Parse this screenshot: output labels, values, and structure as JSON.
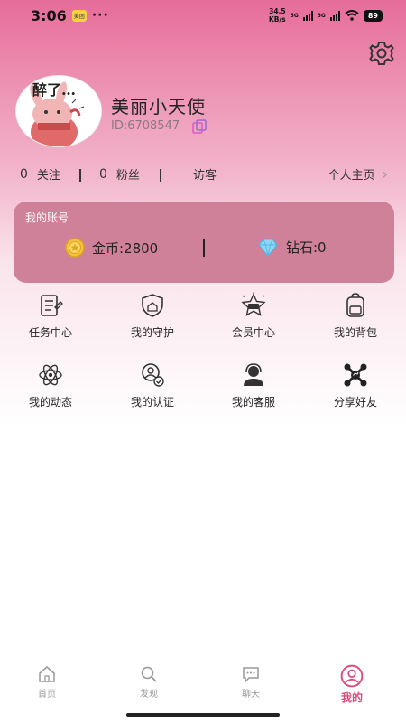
{
  "status_bar": {
    "time": "3:06",
    "notif_label": "美团",
    "dots": "···",
    "speed_top": "34.5",
    "speed_bottom": "KB/s",
    "net1": "5G",
    "net2": "5G",
    "battery": "89"
  },
  "profile": {
    "avatar_text": "醉了…",
    "nickname": "美丽小天使",
    "id": "ID:6708547"
  },
  "stats": {
    "following_count": "0",
    "following_label": "关注",
    "fans_count": "0",
    "fans_label": "粉丝",
    "visitors_label": "访客",
    "home_label": "个人主页",
    "chevron": "›"
  },
  "account": {
    "title": "我的账号",
    "gold_label": "金币:2800",
    "diamond_label": "钻石:0"
  },
  "grid": {
    "items": [
      {
        "label": "任务中心",
        "icon": "task-icon"
      },
      {
        "label": "我的守护",
        "icon": "guard-icon"
      },
      {
        "label": "会员中心",
        "icon": "vip-icon"
      },
      {
        "label": "我的背包",
        "icon": "backpack-icon"
      },
      {
        "label": "我的动态",
        "icon": "atom-icon"
      },
      {
        "label": "我的认证",
        "icon": "verify-icon"
      },
      {
        "label": "我的客服",
        "icon": "support-icon"
      },
      {
        "label": "分享好友",
        "icon": "share-icon"
      }
    ]
  },
  "tabbar": {
    "tabs": [
      {
        "label": "首页",
        "icon": "home-icon"
      },
      {
        "label": "发现",
        "icon": "discover-icon"
      },
      {
        "label": "聊天",
        "icon": "chat-icon"
      },
      {
        "label": "我的",
        "icon": "profile-icon",
        "active": true
      }
    ]
  },
  "colors": {
    "accent": "#d94f7c",
    "card": "#cf8199",
    "gradient_top": "#e66c99"
  }
}
